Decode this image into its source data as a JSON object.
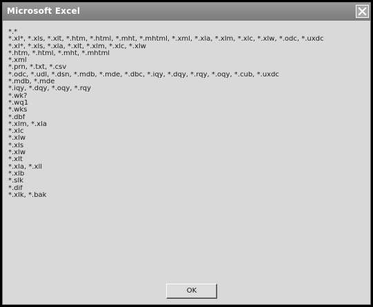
{
  "window": {
    "title": "Microsoft Excel",
    "close_label": "X"
  },
  "message": {
    "lines": [
      "*.*",
      "*.xl*, *.xls, *.xlt, *.htm, *.html, *.mht, *.mhtml, *.xml, *.xla, *.xlm, *.xlc, *.xlw, *.odc, *.uxdc",
      "*.xl*, *.xls, *.xla, *.xlt, *.xlm, *.xlc, *.xlw",
      "*.htm, *.html, *.mht, *.mhtml",
      "*.xml",
      "*.prn, *.txt, *.csv",
      "*.odc, *.udl, *.dsn, *.mdb, *.mde, *.dbc, *.iqy, *.dqy, *.rqy, *.oqy, *.cub, *.uxdc",
      "*.mdb, *.mde",
      "*.iqy, *.dqy, *.oqy, *.rqy",
      "*.wk?",
      "*.wq1",
      "*.wks",
      "*.dbf",
      "*.xlm, *.xla",
      "*.xlc",
      "*.xlw",
      "*.xls",
      "*.xlw",
      "*.xlt",
      "*.xla, *.xll",
      "*.xlb",
      "*.slk",
      "*.dif",
      "*.xlk, *.bak"
    ]
  },
  "buttons": {
    "ok_label": "OK"
  }
}
